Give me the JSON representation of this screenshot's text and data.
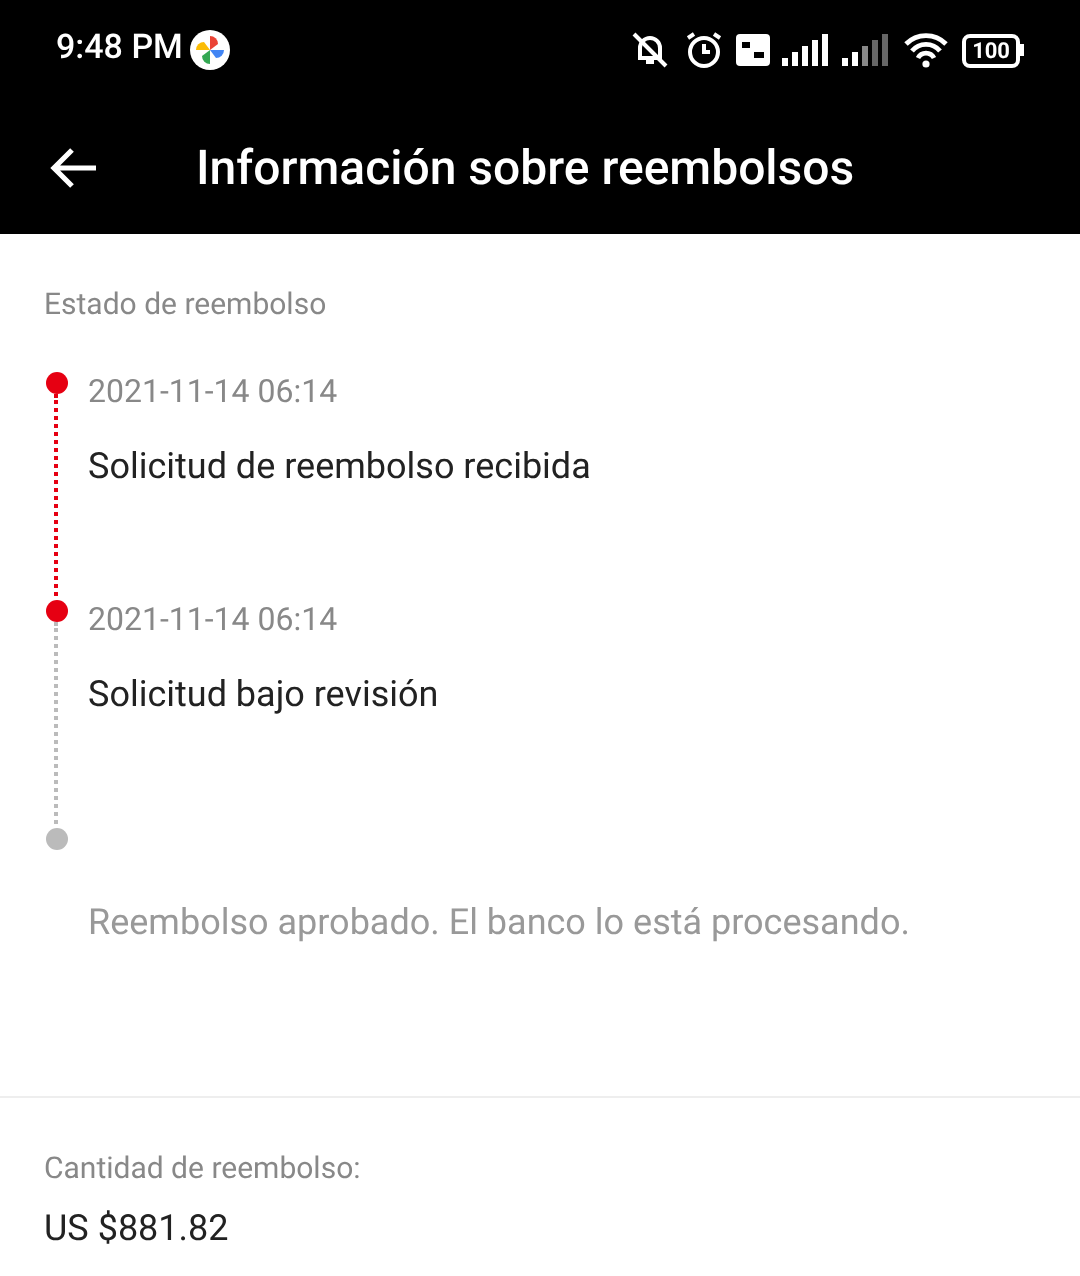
{
  "status_bar": {
    "time": "9:48 PM",
    "battery": "100"
  },
  "header": {
    "title": "Información sobre reembolsos"
  },
  "refund_status": {
    "label": "Estado de reembolso",
    "steps": [
      {
        "time": "2021-11-14 06:14",
        "description": "Solicitud de reembolso recibida",
        "done": true
      },
      {
        "time": "2021-11-14 06:14",
        "description": "Solicitud bajo revisión",
        "done": true
      },
      {
        "description": "Reembolso aprobado. El banco lo está procesando.",
        "done": false
      }
    ]
  },
  "refund_amount": {
    "label": "Cantidad de reembolso:",
    "value": "US $881.82"
  }
}
